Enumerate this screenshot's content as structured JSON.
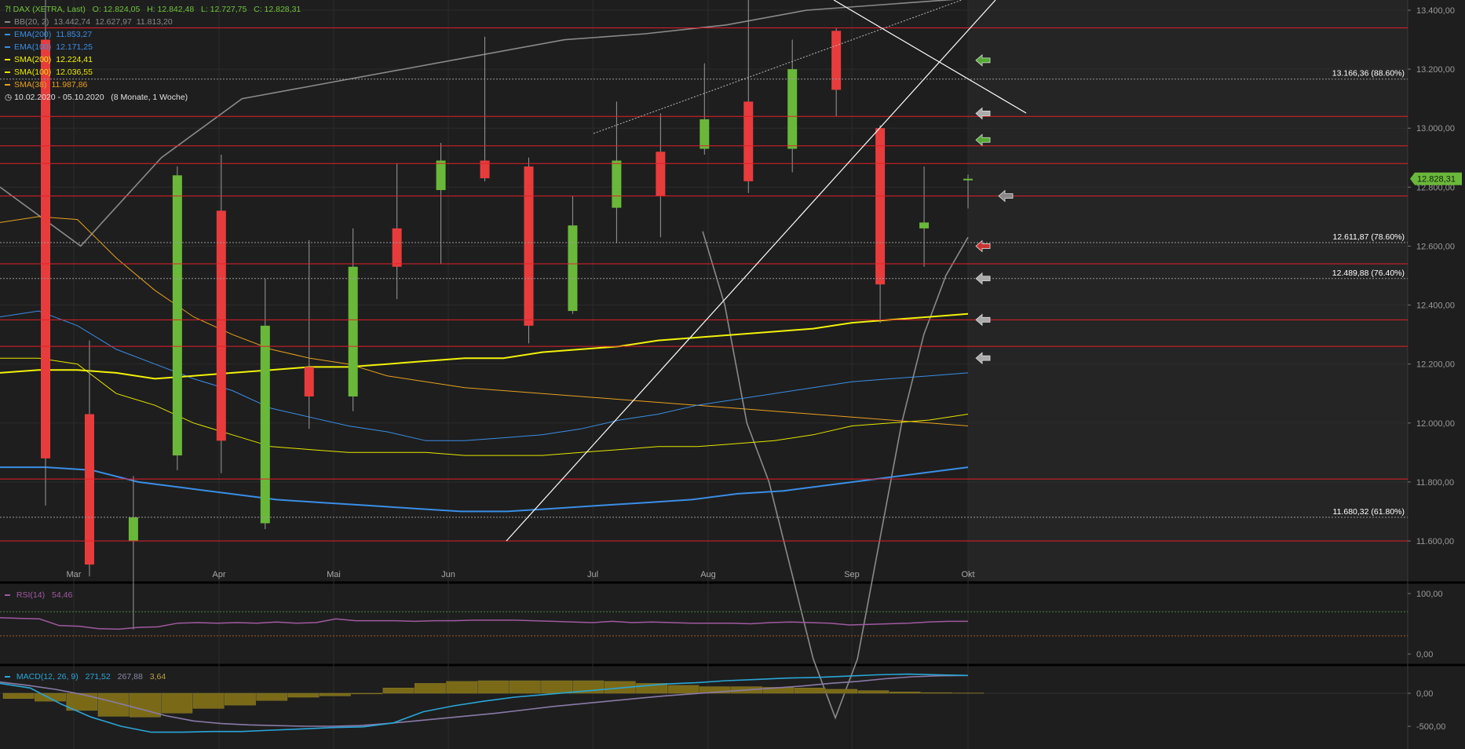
{
  "chart_data": [
    {
      "type": "candlestick",
      "title": "DAX (XETRA, Last)",
      "ohlc_header": {
        "O": "12.824,05",
        "H": "12.842,48",
        "L": "12.727,75",
        "C": "12.828,31"
      },
      "date_range": "10.02.2020 - 05.10.2020",
      "date_range_note": "(8 Monate, 1 Woche)",
      "indicators": [
        {
          "name": "BB(20, 2)",
          "values": [
            "13.442,74",
            "12.627,97",
            "11.813,20"
          ],
          "color": "#8a8a8a"
        },
        {
          "name": "EMA(200)",
          "values": [
            "11.853,27"
          ],
          "color": "#3a8ee6"
        },
        {
          "name": "EMA(100)",
          "values": [
            "12.171,25"
          ],
          "color": "#3a8ee6"
        },
        {
          "name": "SMA(200)",
          "values": [
            "12.224,41"
          ],
          "color": "#f2f20a"
        },
        {
          "name": "SMA(100)",
          "values": [
            "12.036,55"
          ],
          "color": "#e6e600"
        },
        {
          "name": "SMA(38)",
          "values": [
            "11.987,86"
          ],
          "color": "#e8a020"
        }
      ],
      "x_ticks": [
        "Mar",
        "Apr",
        "Mai",
        "Jun",
        "Jul",
        "Aug",
        "Sep",
        "Okt"
      ],
      "y_ticks": [
        "13.400,00",
        "13.200,00",
        "13.000,00",
        "12.800,00",
        "12.600,00",
        "12.400,00",
        "12.200,00",
        "12.000,00",
        "11.800,00",
        "11.600,00"
      ],
      "ylim": [
        11470,
        13450
      ],
      "last_price_label": "12.828,31",
      "last_price": 12828.31,
      "candles": [
        {
          "o": 13300,
          "h": 13790,
          "l": 11720,
          "c": 11880
        },
        {
          "o": 12030,
          "h": 12280,
          "l": 11480,
          "c": 11520
        },
        {
          "o": 11600,
          "h": 11820,
          "l": 11300,
          "c": 11680
        },
        {
          "o": 11890,
          "h": 12870,
          "l": 11840,
          "c": 12840
        },
        {
          "o": 12720,
          "h": 12910,
          "l": 11830,
          "c": 11940
        },
        {
          "o": 11660,
          "h": 12490,
          "l": 11640,
          "c": 12330
        },
        {
          "o": 12190,
          "h": 12620,
          "l": 11980,
          "c": 12090
        },
        {
          "o": 12090,
          "h": 12660,
          "l": 12040,
          "c": 12530
        },
        {
          "o": 12660,
          "h": 12880,
          "l": 12420,
          "c": 12530
        },
        {
          "o": 12790,
          "h": 12950,
          "l": 12540,
          "c": 12890
        },
        {
          "o": 12890,
          "h": 13310,
          "l": 12820,
          "c": 12830
        },
        {
          "o": 12870,
          "h": 12900,
          "l": 12270,
          "c": 12330
        },
        {
          "o": 12380,
          "h": 12770,
          "l": 12370,
          "c": 12670
        },
        {
          "o": 12730,
          "h": 13090,
          "l": 12610,
          "c": 12890
        },
        {
          "o": 12920,
          "h": 13050,
          "l": 12630,
          "c": 12770
        },
        {
          "o": 12930,
          "h": 13220,
          "l": 12910,
          "c": 13030
        },
        {
          "o": 13090,
          "h": 13460,
          "l": 12780,
          "c": 12820
        },
        {
          "o": 12930,
          "h": 13300,
          "l": 12850,
          "c": 13200
        },
        {
          "o": 13330,
          "h": 13340,
          "l": 13040,
          "c": 13130
        },
        {
          "o": 13000,
          "h": 13010,
          "l": 12340,
          "c": 12470
        },
        {
          "o": 12660,
          "h": 12870,
          "l": 12530,
          "c": 12680
        },
        {
          "o": 12824.05,
          "h": 12842.48,
          "l": 12727.75,
          "c": 12828.31
        }
      ],
      "ema200": [
        11850,
        11850,
        11840,
        11800,
        11780,
        11760,
        11740,
        11730,
        11720,
        11710,
        11700,
        11700,
        11710,
        11720,
        11730,
        11740,
        11760,
        11770,
        11790,
        11810,
        11830,
        11850
      ],
      "ema100": [
        12360,
        12380,
        12330,
        12250,
        12200,
        12150,
        12110,
        12050,
        12020,
        11990,
        11970,
        11940,
        11940,
        11950,
        11960,
        11980,
        12010,
        12030,
        12060,
        12080,
        12100,
        12120,
        12140,
        12150,
        12160,
        12170
      ],
      "sma200": [
        12170,
        12180,
        12180,
        12170,
        12150,
        12160,
        12170,
        12180,
        12190,
        12190,
        12200,
        12210,
        12220,
        12220,
        12240,
        12250,
        12260,
        12280,
        12290,
        12300,
        12310,
        12320,
        12340,
        12350,
        12360,
        12370
      ],
      "sma100": [
        12220,
        12220,
        12200,
        12100,
        12060,
        12000,
        11960,
        11920,
        11910,
        11900,
        11900,
        11900,
        11890,
        11890,
        11890,
        11900,
        11910,
        11920,
        11920,
        11930,
        11940,
        11960,
        11990,
        12000,
        12010,
        12030
      ],
      "sma38": [
        12680,
        12700,
        12690,
        12560,
        12450,
        12360,
        12300,
        12250,
        12220,
        12200,
        12160,
        12140,
        12120,
        12110,
        12100,
        12090,
        12080,
        12070,
        12060,
        12050,
        12040,
        12030,
        12020,
        12010,
        12000,
        11990
      ],
      "bb_upper": [
        12800,
        12600,
        12900,
        13100,
        13150,
        13200,
        13250,
        13300,
        13320,
        13350,
        13400,
        13420,
        13440
      ],
      "bb_lower": [
        12650,
        12400,
        12000,
        11800,
        11500,
        11200,
        11000,
        11200,
        11600,
        12000,
        12300,
        12500,
        12630
      ],
      "hlines_red": [
        13340,
        13040,
        12940,
        12880,
        12770,
        12540,
        12350,
        12260,
        11810,
        11600
      ],
      "fib_levels": [
        {
          "label": "13.166,36 (88.60%)",
          "value": 13166.36
        },
        {
          "label": "12.611,87 (78.60%)",
          "value": 12611.87
        },
        {
          "label": "12.489,88 (76.40%)",
          "value": 12489.88
        },
        {
          "label": "11.680,32 (61.80%)",
          "value": 11680.32
        }
      ]
    },
    {
      "type": "line",
      "title": "RSI(14)",
      "value_label": "54,46",
      "y_ticks": [
        "100,00",
        "0,00"
      ],
      "ylim": [
        -10,
        110
      ],
      "levels": [
        70,
        30
      ],
      "values": [
        60,
        59,
        58,
        47,
        46,
        42,
        41,
        44,
        45,
        51,
        52,
        51,
        52,
        51,
        53,
        51,
        52,
        58,
        55,
        55,
        55,
        54,
        55,
        55,
        56,
        56,
        56,
        55,
        54,
        53,
        52,
        54,
        52,
        53,
        52,
        51,
        51,
        51,
        50,
        52,
        53,
        52,
        51,
        48,
        49,
        50,
        51,
        53,
        54,
        54
      ]
    },
    {
      "type": "bar",
      "title": "MACD(12, 26, 9)",
      "values_label": [
        "271,52",
        "267,88",
        "3,64"
      ],
      "y_ticks": [
        "0,00",
        "-500,00"
      ],
      "ylim": [
        -720,
        200
      ],
      "histogram": [
        -80,
        -120,
        -260,
        -350,
        -360,
        -300,
        -230,
        -180,
        -110,
        -60,
        -40,
        -10,
        80,
        150,
        180,
        190,
        190,
        190,
        190,
        180,
        150,
        120,
        100,
        100,
        90,
        80,
        60,
        40,
        20,
        10,
        5
      ],
      "macd": [
        150,
        80,
        -160,
        -360,
        -500,
        -590,
        -590,
        -580,
        -580,
        -560,
        -540,
        -520,
        -510,
        -450,
        -280,
        -190,
        -120,
        -60,
        -20,
        20,
        60,
        100,
        140,
        160,
        190,
        210,
        230,
        240,
        260,
        280,
        290,
        280,
        270
      ],
      "signal": [
        170,
        120,
        60,
        -20,
        -120,
        -230,
        -340,
        -420,
        -460,
        -480,
        -490,
        -500,
        -500,
        -490,
        -460,
        -420,
        -380,
        -340,
        -300,
        -250,
        -200,
        -160,
        -120,
        -80,
        -40,
        -10,
        20,
        50,
        80,
        110,
        150,
        180,
        220,
        250,
        265,
        270
      ]
    }
  ]
}
